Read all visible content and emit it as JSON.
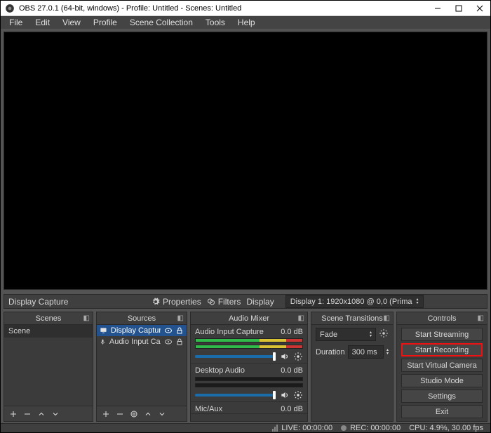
{
  "window": {
    "title": "OBS 27.0.1 (64-bit, windows) - Profile: Untitled - Scenes: Untitled"
  },
  "menu": {
    "file": "File",
    "edit": "Edit",
    "view": "View",
    "profile": "Profile",
    "scene_collection": "Scene Collection",
    "tools": "Tools",
    "help": "Help"
  },
  "propbar": {
    "source_name": "Display Capture",
    "properties": "Properties",
    "filters": "Filters",
    "display_label": "Display",
    "display_value": "Display 1: 1920x1080 @ 0,0 (Prima"
  },
  "docks": {
    "scenes": {
      "title": "Scenes",
      "items": [
        "Scene"
      ]
    },
    "sources": {
      "title": "Sources",
      "items": [
        {
          "label": "Display Capture",
          "icon": "monitor"
        },
        {
          "label": "Audio Input Captu…",
          "icon": "mic"
        }
      ]
    },
    "mixer": {
      "title": "Audio Mixer",
      "channels": [
        {
          "name": "Audio Input Capture",
          "level": "0.0 dB",
          "active": true
        },
        {
          "name": "Desktop Audio",
          "level": "0.0 dB",
          "active": false
        },
        {
          "name": "Mic/Aux",
          "level": "0.0 dB",
          "active": false
        }
      ]
    },
    "transitions": {
      "title": "Scene Transitions",
      "type": "Fade",
      "duration_label": "Duration",
      "duration_value": "300 ms"
    },
    "controls": {
      "title": "Controls",
      "buttons": {
        "stream": "Start Streaming",
        "record": "Start Recording",
        "vcam": "Start Virtual Camera",
        "studio": "Studio Mode",
        "settings": "Settings",
        "exit": "Exit"
      }
    }
  },
  "status": {
    "live": "LIVE: 00:00:00",
    "rec": "REC: 00:00:00",
    "cpu": "CPU: 4.9%, 30.00 fps"
  }
}
